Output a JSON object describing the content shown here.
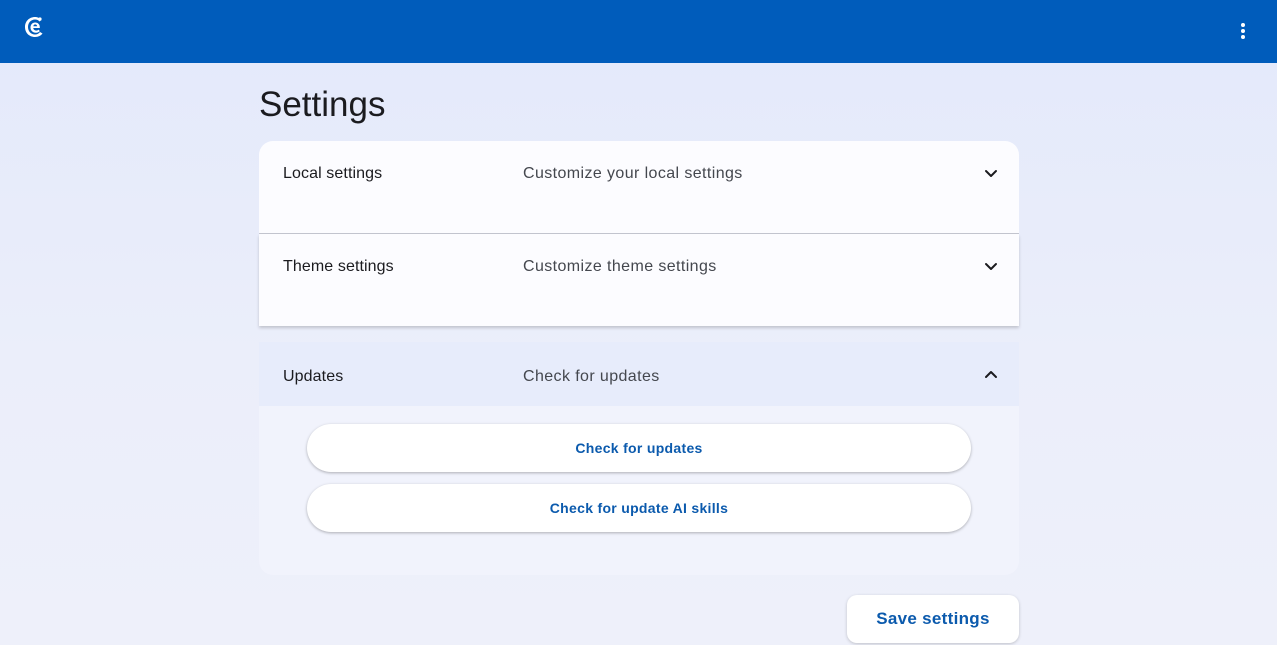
{
  "app": {
    "logo_icon": "app-logo-icon",
    "menu_icon": "more-vertical-icon",
    "accent_color": "#005cbb"
  },
  "page": {
    "title": "Settings"
  },
  "sections": [
    {
      "title": "Local settings",
      "description": "Customize your local settings",
      "expanded": false,
      "icon": "chevron-down-icon"
    },
    {
      "title": "Theme settings",
      "description": "Customize theme settings",
      "expanded": false,
      "icon": "chevron-down-icon"
    },
    {
      "title": "Updates",
      "description": "Check for updates",
      "expanded": true,
      "icon": "chevron-up-icon",
      "buttons": [
        {
          "label": "Check for updates"
        },
        {
          "label": "Check for update AI skills"
        }
      ]
    }
  ],
  "footer": {
    "save_label": "Save settings"
  }
}
